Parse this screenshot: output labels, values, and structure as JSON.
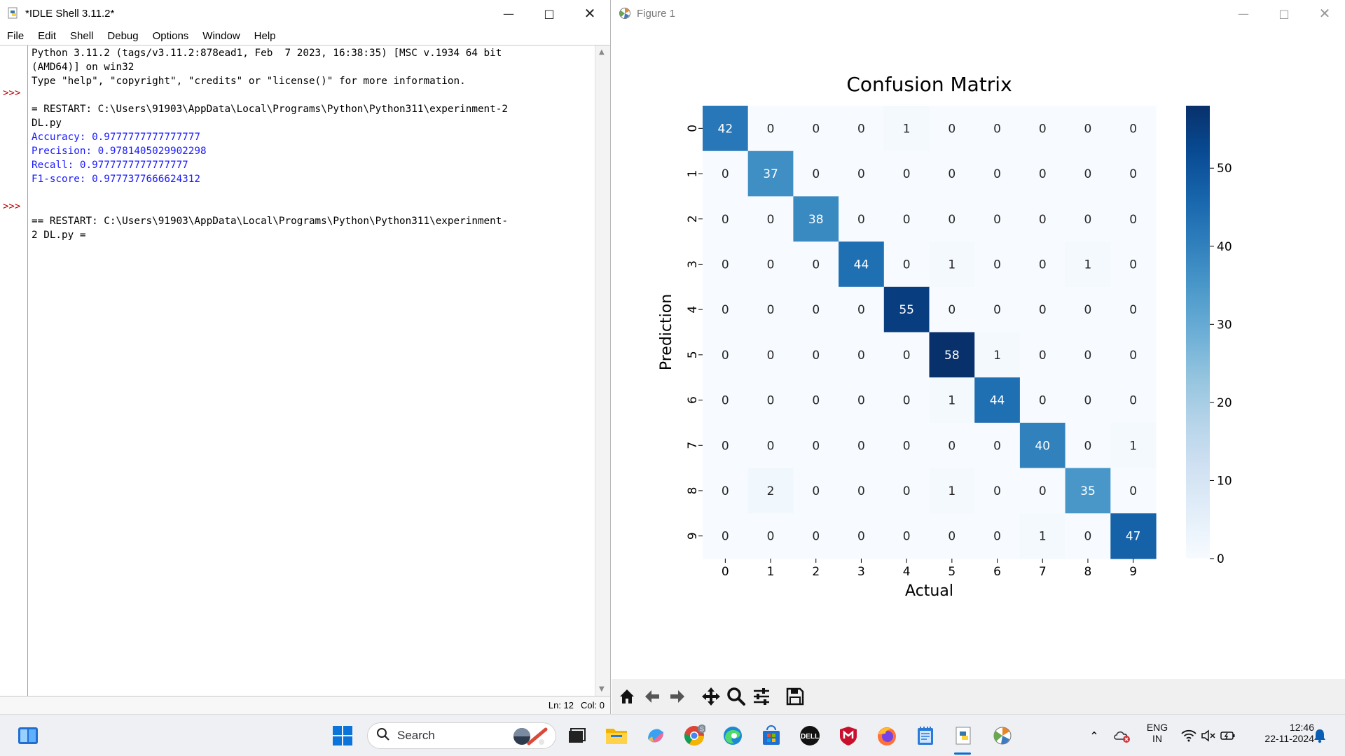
{
  "idle": {
    "title": "*IDLE Shell 3.11.2*",
    "menu": [
      "File",
      "Edit",
      "Shell",
      "Debug",
      "Options",
      "Window",
      "Help"
    ],
    "lines": [
      {
        "text": "Python 3.11.2 (tags/v3.11.2:878ead1, Feb  7 2023, 16:38:35) [MSC v.1934 64 bit",
        "kind": "std"
      },
      {
        "text": "(AMD64)] on win32",
        "kind": "std"
      },
      {
        "text": "Type \"help\", \"copyright\", \"credits\" or \"license()\" for more information.",
        "kind": "std"
      },
      {
        "text": "",
        "kind": "std"
      },
      {
        "text": "= RESTART: C:\\Users\\91903\\AppData\\Local\\Programs\\Python\\Python311\\experinment-2",
        "kind": "std"
      },
      {
        "text": "DL.py",
        "kind": "std"
      },
      {
        "text": "Accuracy: 0.9777777777777777",
        "kind": "out"
      },
      {
        "text": "Precision: 0.9781405029902298",
        "kind": "out"
      },
      {
        "text": "Recall: 0.9777777777777777",
        "kind": "out"
      },
      {
        "text": "F1-score: 0.9777377666624312",
        "kind": "out"
      },
      {
        "text": "",
        "kind": "std"
      },
      {
        "text": "",
        "kind": "std"
      },
      {
        "text": "== RESTART: C:\\Users\\91903\\AppData\\Local\\Programs\\Python\\Python311\\experinment-",
        "kind": "std"
      },
      {
        "text": "2 DL.py =",
        "kind": "std"
      }
    ],
    "prompts": [
      ">>>",
      ">>>"
    ],
    "status": {
      "ln": "Ln: 12",
      "col": "Col: 0"
    }
  },
  "figure": {
    "title": "Figure 1",
    "toolbar": [
      "home-icon",
      "back-icon",
      "forward-icon",
      "pan-icon",
      "zoom-icon",
      "configure-icon",
      "save-icon"
    ]
  },
  "chart_data": {
    "type": "heatmap",
    "title": "Confusion Matrix",
    "xlabel": "Actual",
    "ylabel": "Prediction",
    "x_categories": [
      "0",
      "1",
      "2",
      "3",
      "4",
      "5",
      "6",
      "7",
      "8",
      "9"
    ],
    "y_categories": [
      "0",
      "1",
      "2",
      "3",
      "4",
      "5",
      "6",
      "7",
      "8",
      "9"
    ],
    "matrix": [
      [
        42,
        0,
        0,
        0,
        1,
        0,
        0,
        0,
        0,
        0
      ],
      [
        0,
        37,
        0,
        0,
        0,
        0,
        0,
        0,
        0,
        0
      ],
      [
        0,
        0,
        38,
        0,
        0,
        0,
        0,
        0,
        0,
        0
      ],
      [
        0,
        0,
        0,
        44,
        0,
        1,
        0,
        0,
        1,
        0
      ],
      [
        0,
        0,
        0,
        0,
        55,
        0,
        0,
        0,
        0,
        0
      ],
      [
        0,
        0,
        0,
        0,
        0,
        58,
        1,
        0,
        0,
        0
      ],
      [
        0,
        0,
        0,
        0,
        0,
        1,
        44,
        0,
        0,
        0
      ],
      [
        0,
        0,
        0,
        0,
        0,
        0,
        0,
        40,
        0,
        1
      ],
      [
        0,
        2,
        0,
        0,
        0,
        1,
        0,
        0,
        35,
        0
      ],
      [
        0,
        0,
        0,
        0,
        0,
        0,
        0,
        1,
        0,
        47
      ]
    ],
    "colormap": "Blues",
    "vmin": 0,
    "vmax": 58,
    "colorbar_ticks": [
      0,
      10,
      20,
      30,
      40,
      50
    ],
    "colorbar_tick_labels": [
      "0",
      "10",
      "20",
      "30",
      "40",
      "50"
    ],
    "annotated": true
  },
  "taskbar": {
    "search_label": "Search",
    "lang_top": "ENG",
    "lang_bottom": "IN",
    "time": "12:46",
    "date": "22-11-2024"
  }
}
